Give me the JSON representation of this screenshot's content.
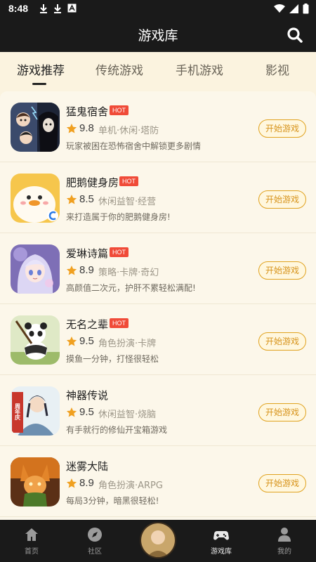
{
  "status": {
    "time": "8:48"
  },
  "header": {
    "title": "游戏库"
  },
  "tabs": [
    {
      "label": "游戏推荐",
      "active": true
    },
    {
      "label": "传统游戏",
      "active": false
    },
    {
      "label": "手机游戏",
      "active": false
    },
    {
      "label": "影视",
      "active": false
    }
  ],
  "play_label": "开始游戏",
  "hot_label": "HOT",
  "games": [
    {
      "name": "猛鬼宿舍",
      "hot": true,
      "score": "9.8",
      "tags": "单机·休闲·塔防",
      "desc": "玩家被困在恐怖宿舍中解锁更多剧情",
      "icon": "ghost-dorm-icon"
    },
    {
      "name": "肥鹅健身房",
      "hot": true,
      "score": "8.5",
      "tags": "休闲益智·经营",
      "desc": "来打造属于你的肥鹅健身房!",
      "icon": "goose-gym-icon"
    },
    {
      "name": "爱琳诗篇",
      "hot": true,
      "score": "8.9",
      "tags": "策略·卡牌·奇幻",
      "desc": "高颜值二次元，护肝不累轻松满配!",
      "icon": "anime-girl-icon"
    },
    {
      "name": "无名之辈",
      "hot": true,
      "score": "9.5",
      "tags": "角色扮演·卡牌",
      "desc": "摸鱼一分钟，打怪很轻松",
      "icon": "panda-icon"
    },
    {
      "name": "神器传说",
      "hot": false,
      "score": "9.5",
      "tags": "休闲益智·烧脑",
      "desc": "有手就行的修仙开宝箱游戏",
      "icon": "cultivator-icon",
      "badge": "周年庆"
    },
    {
      "name": "迷雾大陆",
      "hot": false,
      "score": "8.9",
      "tags": "角色扮演·ARPG",
      "desc": "每局3分钟，暗黑很轻松!",
      "icon": "fox-warrior-icon"
    }
  ],
  "bottom_nav": [
    {
      "label": "首页",
      "icon": "home-icon",
      "active": false
    },
    {
      "label": "社区",
      "icon": "compass-icon",
      "active": false
    },
    {
      "label": "",
      "icon": "avatar",
      "active": false
    },
    {
      "label": "游戏库",
      "icon": "gamepad-icon",
      "active": true
    },
    {
      "label": "我的",
      "icon": "user-icon",
      "active": false
    }
  ],
  "colors": {
    "accent": "#e0a21f",
    "hot": "#f04b38",
    "bar": "#1a1a1a",
    "bg": "#fbf3df"
  }
}
